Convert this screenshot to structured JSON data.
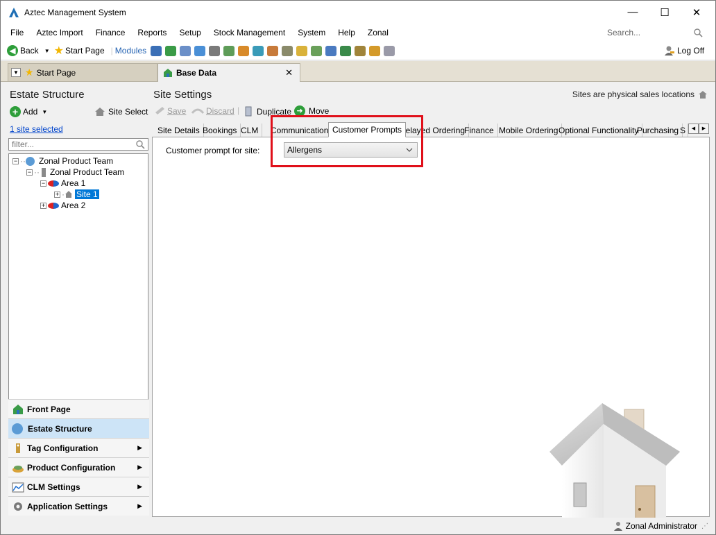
{
  "window": {
    "title": "Aztec Management System",
    "minimize": "—",
    "maximize": "☐",
    "close": "✕"
  },
  "menu": {
    "items": [
      "File",
      "Aztec Import",
      "Finance",
      "Reports",
      "Setup",
      "Stock Management",
      "System",
      "Help",
      "Zonal"
    ],
    "search_placeholder": "Search..."
  },
  "toolbar": {
    "back_label": "Back",
    "start_page_label": "Start Page",
    "modules_label": "Modules",
    "logoff_label": "Log Off"
  },
  "doc_tabs": {
    "start_page": "Start Page",
    "base_data": "Base Data"
  },
  "left_panel": {
    "title": "Estate Structure",
    "add_label": "Add",
    "site_select_label": "Site Select",
    "selection_link": "1 site selected",
    "filter_placeholder": "filter...",
    "tree": {
      "root": "Zonal Product Team",
      "child": "Zonal Product Team",
      "area1": "Area 1",
      "site1": "Site 1",
      "area2": "Area 2"
    },
    "nav": [
      "Front Page",
      "Estate Structure",
      "Tag Configuration",
      "Product Configuration",
      "CLM Settings",
      "Application Settings"
    ]
  },
  "right_panel": {
    "title": "Site Settings",
    "subtitle": "Sites are physical sales locations",
    "actions": {
      "save": "Save",
      "discard": "Discard",
      "duplicate": "Duplicate",
      "move": "Move"
    },
    "tabs": [
      "Site Details",
      "Bookings",
      "CLM",
      "Communications",
      "Customer Prompts",
      "Delayed Ordering",
      "Finance",
      "Mobile Ordering",
      "Optional Functionality",
      "Purchasing",
      "S"
    ],
    "active_tab": "Customer Prompts",
    "field_label": "Customer prompt for site:",
    "field_value": "Allergens"
  },
  "status": {
    "user": "Zonal Administrator"
  },
  "colors": {
    "highlight_red": "#e0101a",
    "selection_blue": "#0078d7",
    "nav_active": "#cde4f7"
  }
}
